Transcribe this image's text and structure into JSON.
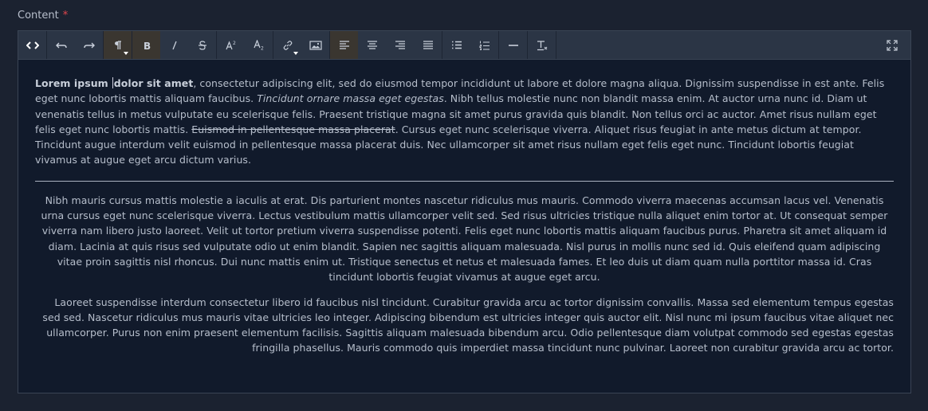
{
  "field": {
    "label": "Content",
    "required_mark": "*"
  },
  "toolbar": {
    "buttons": [
      {
        "icon": "code-view-icon",
        "tooltip": "Code view"
      },
      {
        "icon": "undo-icon"
      },
      {
        "icon": "redo-icon"
      },
      {
        "icon": "paragraph-icon",
        "active": true,
        "dropdown": true
      },
      {
        "icon": "bold-icon",
        "active": true
      },
      {
        "icon": "italic-icon"
      },
      {
        "icon": "strikethrough-icon"
      },
      {
        "icon": "superscript-icon"
      },
      {
        "icon": "subscript-icon"
      },
      {
        "icon": "link-icon",
        "dropdown": true
      },
      {
        "icon": "image-icon"
      },
      {
        "icon": "align-left-icon",
        "active": true
      },
      {
        "icon": "align-center-icon"
      },
      {
        "icon": "align-right-icon"
      },
      {
        "icon": "align-justify-icon"
      },
      {
        "icon": "bullet-list-icon"
      },
      {
        "icon": "ordered-list-icon"
      },
      {
        "icon": "horizontal-rule-icon"
      },
      {
        "icon": "clear-format-icon"
      },
      {
        "icon": "fullscreen-icon"
      }
    ]
  },
  "content": {
    "p1": {
      "bold": "Lorem ipsum",
      "bold2": "dolor sit amet",
      "t1": ", consectetur adipiscing elit, sed do eiusmod tempor incididunt ut labore et dolore magna aliqua. Dignissim suspendisse in est ante. Felis eget nunc lobortis mattis aliquam faucibus. ",
      "italic": "Tincidunt ornare massa eget egestas",
      "t2": ". Nibh tellus molestie nunc non blandit massa enim. At auctor urna nunc id. Diam ut venenatis tellus in metus vulputate eu scelerisque felis. Praesent tristique magna sit amet purus gravida quis blandit. Non tellus orci ac auctor. Amet risus nullam eget felis eget nunc lobortis mattis. ",
      "strike": "Euismod in pellentesque massa placerat",
      "t3": ". Cursus eget nunc scelerisque viverra. Aliquet risus feugiat in ante metus dictum at tempor. Tincidunt augue interdum velit euismod in pellentesque massa placerat duis. Nec ullamcorper sit amet risus nullam eget felis eget nunc. Tincidunt lobortis feugiat vivamus at augue eget arcu dictum varius."
    },
    "p2": "Nibh mauris cursus mattis molestie a iaculis at erat. Dis parturient montes nascetur ridiculus mus mauris. Commodo viverra maecenas accumsan lacus vel. Venenatis urna cursus eget nunc scelerisque viverra. Lectus vestibulum mattis ullamcorper velit sed. Sed risus ultricies tristique nulla aliquet enim tortor at. Ut consequat semper viverra nam libero justo laoreet. Velit ut tortor pretium viverra suspendisse potenti. Felis eget nunc lobortis mattis aliquam faucibus purus. Pharetra sit amet aliquam id diam. Lacinia at quis risus sed vulputate odio ut enim blandit. Sapien nec sagittis aliquam malesuada. Nisl purus in mollis nunc sed id. Quis eleifend quam adipiscing vitae proin sagittis nisl rhoncus. Dui nunc mattis enim ut. Tristique senectus et netus et malesuada fames. Et leo duis ut diam quam nulla porttitor massa id. Cras tincidunt lobortis feugiat vivamus at augue eget arcu.",
    "p3": "Laoreet suspendisse interdum consectetur libero id faucibus nisl tincidunt. Curabitur gravida arcu ac tortor dignissim convallis. Massa sed elementum tempus egestas sed sed. Nascetur ridiculus mus mauris vitae ultricies leo integer. Adipiscing bibendum est ultricies integer quis auctor elit. Nisl nunc mi ipsum faucibus vitae aliquet nec ullamcorper. Purus non enim praesent elementum facilisis. Sagittis aliquam malesuada bibendum arcu. Odio pellentesque diam volutpat commodo sed egestas egestas fringilla phasellus. Mauris commodo quis imperdiet massa tincidunt nunc pulvinar. Laoreet non curabitur gravida arcu ac tortor."
  },
  "colors": {
    "background": "#1b2230",
    "toolbar": "#2b3545",
    "editor": "#111a2b",
    "required": "#e2464d",
    "active": "#3a3630"
  }
}
